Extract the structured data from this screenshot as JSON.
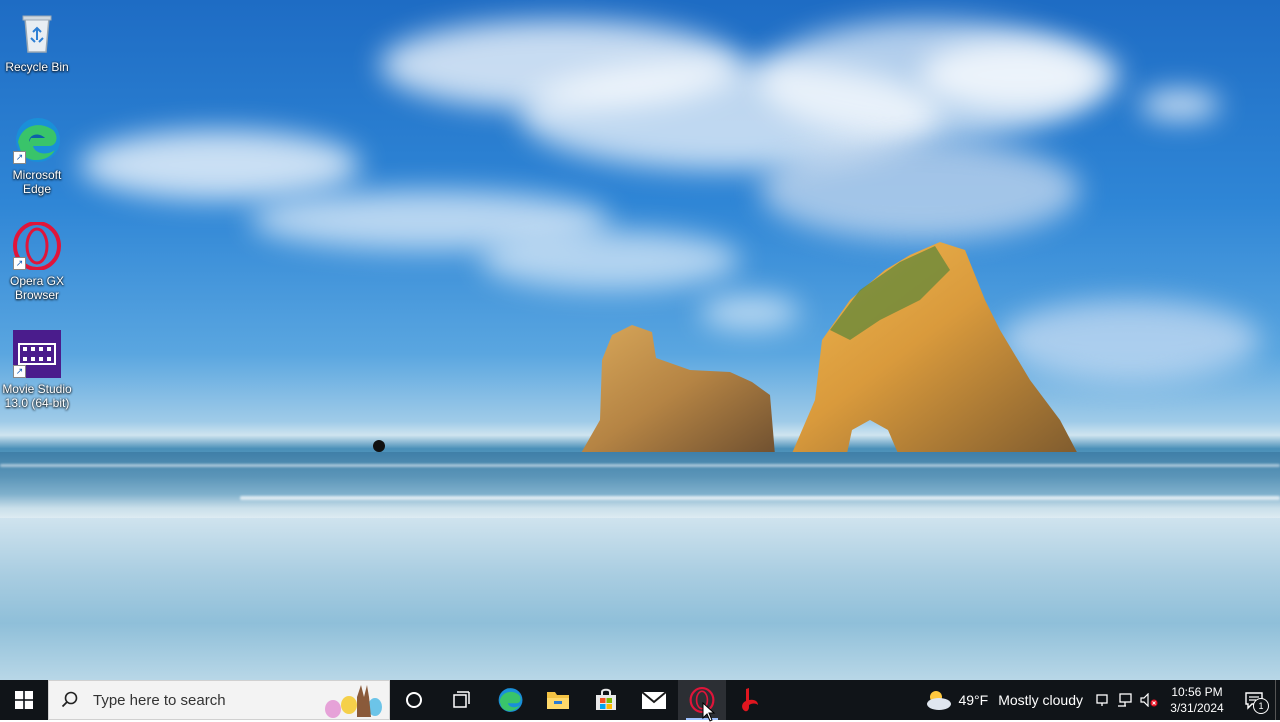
{
  "desktop": {
    "icons": [
      {
        "label": "Recycle Bin",
        "icon": "recycle-bin-icon"
      },
      {
        "label": "Microsoft Edge",
        "icon": "edge-icon"
      },
      {
        "label": "Opera GX Browser",
        "icon": "opera-gx-icon"
      },
      {
        "label": "Movie Studio 13.0 (64-bit)",
        "icon": "movie-studio-icon"
      }
    ]
  },
  "taskbar": {
    "search_placeholder": "Type here to search",
    "pinned": [
      "cortana-icon",
      "task-view-icon",
      "edge-icon",
      "file-explorer-icon",
      "microsoft-store-icon",
      "mail-icon",
      "opera-gx-icon",
      "red-app-icon"
    ],
    "active_app": "opera-gx-icon"
  },
  "tray": {
    "temperature": "49°F",
    "weather": "Mostly cloudy",
    "time": "10:56 PM",
    "date": "3/31/2024",
    "notification_count": "1"
  },
  "colors": {
    "taskbar": "#101418",
    "accent": "#0078d7",
    "opera": "#e0153a"
  }
}
